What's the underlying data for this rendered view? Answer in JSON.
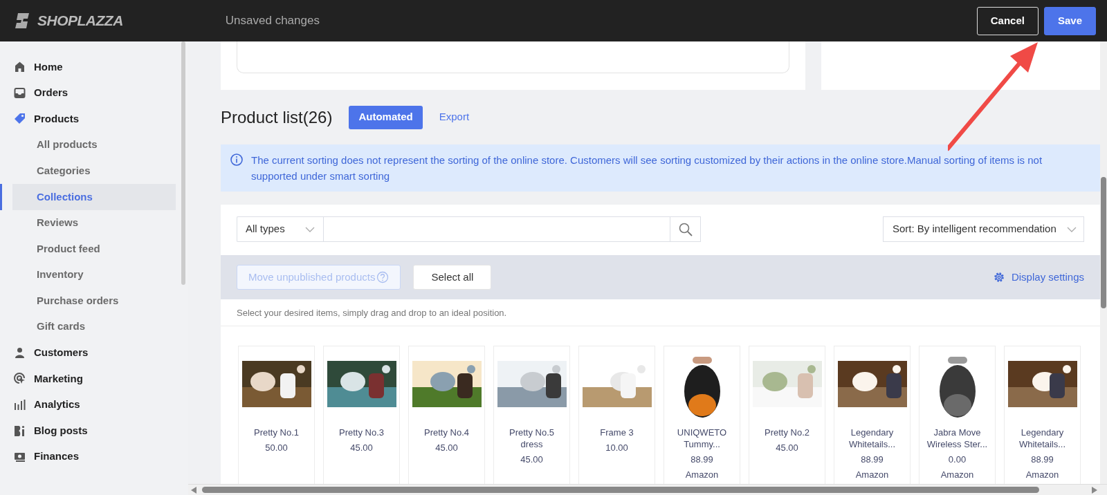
{
  "header": {
    "logo": "SHOPLAZZA",
    "title": "Unsaved changes",
    "buttons": [
      {
        "label": "Cancel",
        "kind": "outline"
      },
      {
        "label": "Save",
        "kind": "primary"
      }
    ]
  },
  "sidebar": {
    "items": [
      {
        "label": "Home",
        "selected": false,
        "active": false
      },
      {
        "label": "Orders",
        "selected": false,
        "active": false
      },
      {
        "label": "Products",
        "selected": false,
        "active": true,
        "children": [
          {
            "label": "All products",
            "selected": false
          },
          {
            "label": "Categories",
            "selected": false
          },
          {
            "label": "Collections",
            "selected": true
          },
          {
            "label": "Reviews",
            "selected": false
          },
          {
            "label": "Product feed",
            "selected": false
          },
          {
            "label": "Inventory",
            "selected": false
          },
          {
            "label": "Purchase orders",
            "selected": false
          },
          {
            "label": "Gift cards",
            "selected": false
          }
        ]
      },
      {
        "label": "Customers",
        "selected": false,
        "active": false
      },
      {
        "label": "Marketing",
        "selected": false,
        "active": false
      },
      {
        "label": "Analytics",
        "selected": false,
        "active": false
      },
      {
        "label": "Blog posts",
        "selected": false,
        "active": false
      },
      {
        "label": "Finances",
        "selected": false,
        "active": false
      }
    ]
  },
  "product_list": {
    "title": "Product list(26)",
    "mode_button": "Automated",
    "export_link": "Export",
    "alert": "The current sorting does not represent the sorting of the online store. Customers will see sorting customized by their actions in the online store.Manual sorting of items is not supported under smart sorting",
    "type_filter": "All types",
    "sort": "Sort: By intelligent recommendation",
    "move_button": {
      "label": "Move unpublished products",
      "disabled": true
    },
    "select_all": "Select all",
    "display_settings": "Display settings",
    "hint": "Select your desired items, simply drag and drop to an ideal position.",
    "products": [
      {
        "name": "Pretty No.1",
        "price": "50.00"
      },
      {
        "name": "Pretty No.3",
        "price": "45.00"
      },
      {
        "name": "Pretty No.4",
        "price": "45.00"
      },
      {
        "name": "Pretty No.5 dress",
        "price": "45.00"
      },
      {
        "name": "Frame 3",
        "price": "10.00"
      },
      {
        "name": "UNIQWETO Tummy...",
        "price": "88.99",
        "source": "Amazon"
      },
      {
        "name": "Pretty No.2",
        "price": "45.00"
      },
      {
        "name": "Legendary Whitetails...",
        "price": "88.99",
        "source": "Amazon"
      },
      {
        "name": "Jabra Move Wireless Ster...",
        "price": "0.00",
        "source": "Amazon"
      },
      {
        "name": "Legendary Whitetails...",
        "price": "88.99",
        "source": "Amazon"
      }
    ]
  }
}
